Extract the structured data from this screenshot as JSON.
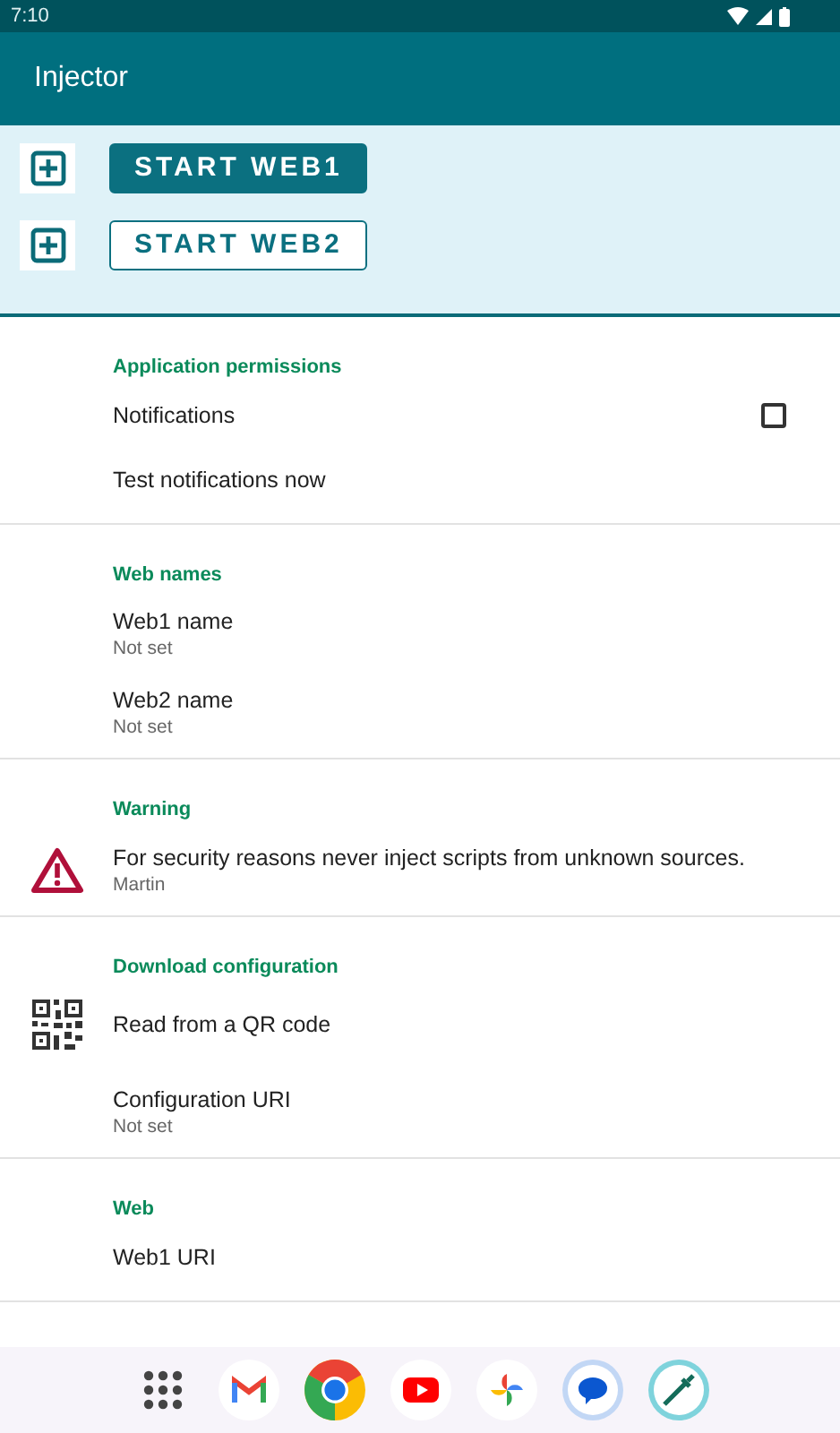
{
  "status_bar": {
    "time": "7:10"
  },
  "app_bar": {
    "title": "Injector"
  },
  "launch_rows": [
    {
      "label": "START WEB1",
      "kind": "filled"
    },
    {
      "label": "START WEB2",
      "kind": "outlined"
    }
  ],
  "sections": [
    {
      "title": "Application permissions",
      "items": [
        {
          "kind": "checkbox",
          "title": "Notifications",
          "checked": false
        },
        {
          "kind": "text",
          "title": "Test notifications now"
        }
      ]
    },
    {
      "title": "Web names",
      "items": [
        {
          "kind": "text",
          "title": "Web1 name",
          "summary": "Not set"
        },
        {
          "kind": "text",
          "title": "Web2 name",
          "summary": "Not set"
        }
      ]
    },
    {
      "title": "Warning",
      "items": [
        {
          "kind": "warning",
          "title": "For security reasons never inject scripts from unknown sources.",
          "summary": "Martin"
        }
      ]
    },
    {
      "title": "Download configuration",
      "items": [
        {
          "kind": "qr",
          "title": "Read from a QR code"
        },
        {
          "kind": "text",
          "title": "Configuration URI",
          "summary": "Not set"
        }
      ]
    },
    {
      "title": "Web",
      "items": [
        {
          "kind": "text",
          "title": "Web1 URI"
        }
      ]
    }
  ],
  "dock": [
    {
      "kind": "grid"
    },
    {
      "kind": "mail"
    },
    {
      "kind": "browser"
    },
    {
      "kind": "video"
    },
    {
      "kind": "photos"
    },
    {
      "kind": "messages"
    },
    {
      "kind": "syringe"
    }
  ]
}
